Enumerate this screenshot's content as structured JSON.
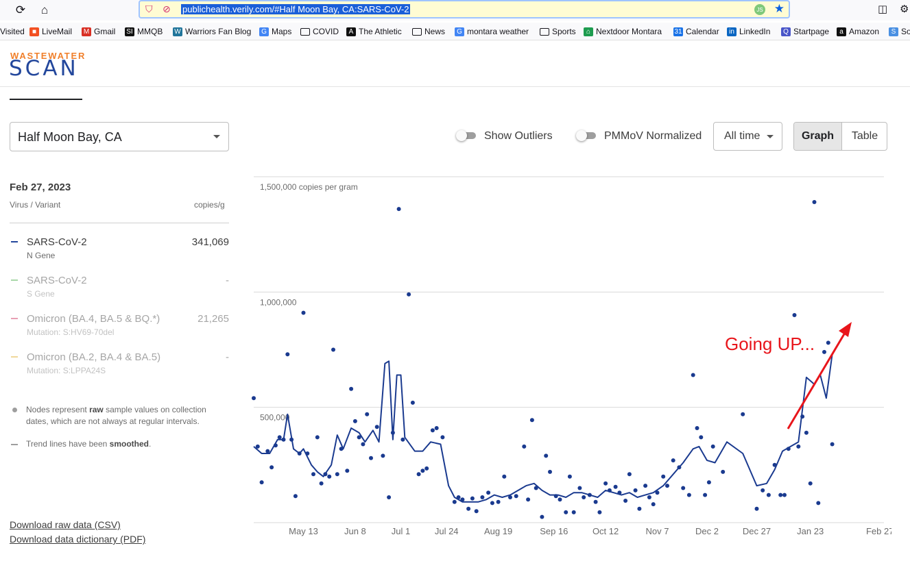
{
  "browser": {
    "url": "publichealth.verily.com/#Half Moon Bay, CA:SARS-CoV-2",
    "bookmarks": [
      {
        "label": "Visited",
        "icon": "folder-icon"
      },
      {
        "label": "LiveMail",
        "icon": "microsoft-icon",
        "color": "#f25022"
      },
      {
        "label": "Gmail",
        "icon": "gmail-icon",
        "color": "#d93025"
      },
      {
        "label": "MMQB",
        "icon": "si-icon",
        "color": "#111111"
      },
      {
        "label": "Warriors Fan Blog",
        "icon": "wordpress-icon",
        "color": "#21759b"
      },
      {
        "label": "Maps",
        "icon": "google-icon",
        "color": "#4285f4"
      },
      {
        "label": "COVID",
        "icon": "folder-icon"
      },
      {
        "label": "The Athletic",
        "icon": "athletic-icon",
        "color": "#111111"
      },
      {
        "label": "News",
        "icon": "folder-icon"
      },
      {
        "label": "montara weather",
        "icon": "google-icon",
        "color": "#4285f4"
      },
      {
        "label": "Sports",
        "icon": "folder-icon"
      },
      {
        "label": "Nextdoor Montara",
        "icon": "nextdoor-icon",
        "color": "#1e9c4f"
      },
      {
        "label": "Calendar",
        "icon": "calendar-icon",
        "color": "#1a73e8"
      },
      {
        "label": "LinkedIn",
        "icon": "linkedin-icon",
        "color": "#0a66c2"
      },
      {
        "label": "Startpage",
        "icon": "startpage-icon",
        "color": "#4a56c9"
      },
      {
        "label": "Amazon",
        "icon": "amazon-icon",
        "color": "#111111"
      },
      {
        "label": "So",
        "icon": "so-icon",
        "color": "#4a90e2"
      }
    ]
  },
  "logo": {
    "top": "WASTEWATER",
    "bottom": "SCAN"
  },
  "location": {
    "selected": "Half Moon Bay, CA"
  },
  "controls": {
    "show_outliers": "Show Outliers",
    "pmmov": "PMMoV Normalized",
    "range": "All time",
    "graph": "Graph",
    "table": "Table"
  },
  "sidebar": {
    "date": "Feb 27, 2023",
    "col_variant": "Virus / Variant",
    "col_units": "copies/g",
    "variants": [
      {
        "name": "SARS-CoV-2",
        "sub": "N Gene",
        "value": "341,069",
        "color": "#23479c",
        "active": true
      },
      {
        "name": "SARS-CoV-2",
        "sub": "S Gene",
        "value": "-",
        "color": "#a8d8a8",
        "active": false
      },
      {
        "name": "Omicron (BA.4, BA.5 & BQ.*)",
        "sub": "Mutation: S:HV69-70del",
        "value": "21,265",
        "color": "#e8a0b4",
        "active": false
      },
      {
        "name": "Omicron (BA.2, BA.4 & BA.5)",
        "sub": "Mutation: S:LPPA24S",
        "value": "-",
        "color": "#f0d89a",
        "active": false
      }
    ],
    "note1_a": "Nodes represent ",
    "note1_b": "raw",
    "note1_c": " sample values on collection dates, which are not always at regular intervals.",
    "note2_a": "Trend lines have been ",
    "note2_b": "smoothed",
    "note2_c": ".",
    "download_csv": "Download raw data (CSV)",
    "download_pdf": "Download data dictionary (PDF)"
  },
  "chart_data": {
    "type": "scatter",
    "ylabel": "1,500,000 copies per gram",
    "ylim": [
      0,
      1500000
    ],
    "yticks": [
      {
        "value": 1500000,
        "label": "1,500,000 copies per gram"
      },
      {
        "value": 1000000,
        "label": "1,000,000"
      },
      {
        "value": 500000,
        "label": "500,000"
      }
    ],
    "xlim": [
      "2022-04-18",
      "2023-03-01"
    ],
    "xticks": [
      {
        "date": "2022-05-13",
        "label": "May 13"
      },
      {
        "date": "2022-06-08",
        "label": "Jun 8"
      },
      {
        "date": "2022-07-01",
        "label": "Jul 1"
      },
      {
        "date": "2022-07-24",
        "label": "Jul 24"
      },
      {
        "date": "2022-08-19",
        "label": "Aug 19"
      },
      {
        "date": "2022-09-16",
        "label": "Sep 16"
      },
      {
        "date": "2022-10-12",
        "label": "Oct 12"
      },
      {
        "date": "2022-11-07",
        "label": "Nov 7"
      },
      {
        "date": "2022-12-02",
        "label": "Dec 2"
      },
      {
        "date": "2022-12-27",
        "label": "Dec 27"
      },
      {
        "date": "2023-01-23",
        "label": "Jan 23"
      },
      {
        "date": "2023-02-27",
        "label": "Feb 27"
      }
    ],
    "series": [
      {
        "color": "#1a3a8f",
        "points": [
          [
            "2022-04-18",
            540000
          ],
          [
            "2022-04-20",
            330000
          ],
          [
            "2022-04-22",
            175000
          ],
          [
            "2022-04-25",
            310000
          ],
          [
            "2022-04-27",
            240000
          ],
          [
            "2022-04-29",
            335000
          ],
          [
            "2022-05-01",
            370000
          ],
          [
            "2022-05-03",
            360000
          ],
          [
            "2022-05-05",
            730000
          ],
          [
            "2022-05-07",
            360000
          ],
          [
            "2022-05-09",
            115000
          ],
          [
            "2022-05-11",
            300000
          ],
          [
            "2022-05-13",
            910000
          ],
          [
            "2022-05-15",
            300000
          ],
          [
            "2022-05-18",
            210000
          ],
          [
            "2022-05-20",
            370000
          ],
          [
            "2022-05-22",
            170000
          ],
          [
            "2022-05-24",
            210000
          ],
          [
            "2022-05-26",
            200000
          ],
          [
            "2022-05-28",
            750000
          ],
          [
            "2022-05-30",
            210000
          ],
          [
            "2022-06-01",
            320000
          ],
          [
            "2022-06-04",
            225000
          ],
          [
            "2022-06-06",
            580000
          ],
          [
            "2022-06-08",
            440000
          ],
          [
            "2022-06-10",
            370000
          ],
          [
            "2022-06-12",
            340000
          ],
          [
            "2022-06-14",
            470000
          ],
          [
            "2022-06-16",
            280000
          ],
          [
            "2022-06-19",
            415000
          ],
          [
            "2022-06-22",
            290000
          ],
          [
            "2022-06-25",
            110000
          ],
          [
            "2022-06-27",
            390000
          ],
          [
            "2022-06-30",
            1360000
          ],
          [
            "2022-07-02",
            360000
          ],
          [
            "2022-07-05",
            990000
          ],
          [
            "2022-07-07",
            520000
          ],
          [
            "2022-07-10",
            210000
          ],
          [
            "2022-07-12",
            225000
          ],
          [
            "2022-07-14",
            235000
          ],
          [
            "2022-07-17",
            400000
          ],
          [
            "2022-07-19",
            410000
          ],
          [
            "2022-07-22",
            370000
          ],
          [
            "2022-07-28",
            90000
          ],
          [
            "2022-07-30",
            110000
          ],
          [
            "2022-08-01",
            100000
          ],
          [
            "2022-08-04",
            60000
          ],
          [
            "2022-08-06",
            105000
          ],
          [
            "2022-08-08",
            50000
          ],
          [
            "2022-08-11",
            110000
          ],
          [
            "2022-08-14",
            130000
          ],
          [
            "2022-08-16",
            85000
          ],
          [
            "2022-08-19",
            90000
          ],
          [
            "2022-08-22",
            200000
          ],
          [
            "2022-08-25",
            110000
          ],
          [
            "2022-08-28",
            115000
          ],
          [
            "2022-09-01",
            330000
          ],
          [
            "2022-09-03",
            100000
          ],
          [
            "2022-09-05",
            445000
          ],
          [
            "2022-09-07",
            150000
          ],
          [
            "2022-09-10",
            25000
          ],
          [
            "2022-09-12",
            290000
          ],
          [
            "2022-09-14",
            220000
          ],
          [
            "2022-09-17",
            115000
          ],
          [
            "2022-09-19",
            100000
          ],
          [
            "2022-09-22",
            45000
          ],
          [
            "2022-09-24",
            200000
          ],
          [
            "2022-09-26",
            45000
          ],
          [
            "2022-09-29",
            150000
          ],
          [
            "2022-10-01",
            110000
          ],
          [
            "2022-10-04",
            120000
          ],
          [
            "2022-10-07",
            90000
          ],
          [
            "2022-10-09",
            45000
          ],
          [
            "2022-10-12",
            170000
          ],
          [
            "2022-10-14",
            140000
          ],
          [
            "2022-10-17",
            155000
          ],
          [
            "2022-10-19",
            130000
          ],
          [
            "2022-10-22",
            95000
          ],
          [
            "2022-10-24",
            210000
          ],
          [
            "2022-10-27",
            140000
          ],
          [
            "2022-10-29",
            60000
          ],
          [
            "2022-11-01",
            160000
          ],
          [
            "2022-11-03",
            110000
          ],
          [
            "2022-11-05",
            80000
          ],
          [
            "2022-11-07",
            130000
          ],
          [
            "2022-11-10",
            200000
          ],
          [
            "2022-11-12",
            160000
          ],
          [
            "2022-11-15",
            270000
          ],
          [
            "2022-11-18",
            240000
          ],
          [
            "2022-11-20",
            150000
          ],
          [
            "2022-11-23",
            120000
          ],
          [
            "2022-11-25",
            640000
          ],
          [
            "2022-11-27",
            410000
          ],
          [
            "2022-11-29",
            370000
          ],
          [
            "2022-12-01",
            120000
          ],
          [
            "2022-12-03",
            175000
          ],
          [
            "2022-12-05",
            330000
          ],
          [
            "2022-12-10",
            220000
          ],
          [
            "2022-12-20",
            470000
          ],
          [
            "2022-12-27",
            60000
          ],
          [
            "2022-12-30",
            140000
          ],
          [
            "2023-01-02",
            120000
          ],
          [
            "2023-01-05",
            250000
          ],
          [
            "2023-01-08",
            120000
          ],
          [
            "2023-01-10",
            120000
          ],
          [
            "2023-01-12",
            320000
          ],
          [
            "2023-01-15",
            900000
          ],
          [
            "2023-01-17",
            330000
          ],
          [
            "2023-01-19",
            460000
          ],
          [
            "2023-01-21",
            390000
          ],
          [
            "2023-01-23",
            170000
          ],
          [
            "2023-01-25",
            1390000
          ],
          [
            "2023-01-27",
            85000
          ],
          [
            "2023-01-30",
            740000
          ],
          [
            "2023-02-01",
            780000
          ],
          [
            "2023-02-03",
            340000
          ]
        ],
        "trend": [
          [
            "2022-04-18",
            330000
          ],
          [
            "2022-04-22",
            300000
          ],
          [
            "2022-04-26",
            300000
          ],
          [
            "2022-04-30",
            360000
          ],
          [
            "2022-05-03",
            360000
          ],
          [
            "2022-05-05",
            470000
          ],
          [
            "2022-05-08",
            320000
          ],
          [
            "2022-05-11",
            300000
          ],
          [
            "2022-05-13",
            320000
          ],
          [
            "2022-05-17",
            250000
          ],
          [
            "2022-05-20",
            220000
          ],
          [
            "2022-05-23",
            200000
          ],
          [
            "2022-05-27",
            250000
          ],
          [
            "2022-05-30",
            380000
          ],
          [
            "2022-06-02",
            320000
          ],
          [
            "2022-06-06",
            410000
          ],
          [
            "2022-06-10",
            390000
          ],
          [
            "2022-06-13",
            350000
          ],
          [
            "2022-06-17",
            400000
          ],
          [
            "2022-06-20",
            350000
          ],
          [
            "2022-06-23",
            690000
          ],
          [
            "2022-06-25",
            700000
          ],
          [
            "2022-06-27",
            360000
          ],
          [
            "2022-06-29",
            640000
          ],
          [
            "2022-07-01",
            640000
          ],
          [
            "2022-07-03",
            370000
          ],
          [
            "2022-07-08",
            310000
          ],
          [
            "2022-07-12",
            310000
          ],
          [
            "2022-07-16",
            350000
          ],
          [
            "2022-07-21",
            340000
          ],
          [
            "2022-07-25",
            160000
          ],
          [
            "2022-07-28",
            110000
          ],
          [
            "2022-08-01",
            90000
          ],
          [
            "2022-08-05",
            90000
          ],
          [
            "2022-08-09",
            90000
          ],
          [
            "2022-08-13",
            100000
          ],
          [
            "2022-08-17",
            120000
          ],
          [
            "2022-08-21",
            110000
          ],
          [
            "2022-08-25",
            120000
          ],
          [
            "2022-08-29",
            140000
          ],
          [
            "2022-09-02",
            160000
          ],
          [
            "2022-09-06",
            170000
          ],
          [
            "2022-09-10",
            140000
          ],
          [
            "2022-09-14",
            120000
          ],
          [
            "2022-09-18",
            120000
          ],
          [
            "2022-09-22",
            110000
          ],
          [
            "2022-09-26",
            130000
          ],
          [
            "2022-09-30",
            130000
          ],
          [
            "2022-10-04",
            120000
          ],
          [
            "2022-10-08",
            110000
          ],
          [
            "2022-10-12",
            140000
          ],
          [
            "2022-10-16",
            130000
          ],
          [
            "2022-10-20",
            120000
          ],
          [
            "2022-10-24",
            130000
          ],
          [
            "2022-10-28",
            110000
          ],
          [
            "2022-11-01",
            120000
          ],
          [
            "2022-11-05",
            130000
          ],
          [
            "2022-11-10",
            160000
          ],
          [
            "2022-11-15",
            210000
          ],
          [
            "2022-11-20",
            260000
          ],
          [
            "2022-11-25",
            320000
          ],
          [
            "2022-11-28",
            330000
          ],
          [
            "2022-12-02",
            270000
          ],
          [
            "2022-12-06",
            260000
          ],
          [
            "2022-12-12",
            350000
          ],
          [
            "2022-12-20",
            300000
          ],
          [
            "2022-12-27",
            160000
          ],
          [
            "2023-01-01",
            170000
          ],
          [
            "2023-01-05",
            230000
          ],
          [
            "2023-01-09",
            310000
          ],
          [
            "2023-01-13",
            330000
          ],
          [
            "2023-01-17",
            350000
          ],
          [
            "2023-01-21",
            630000
          ],
          [
            "2023-01-25",
            600000
          ],
          [
            "2023-01-28",
            640000
          ],
          [
            "2023-01-31",
            540000
          ],
          [
            "2023-02-03",
            730000
          ]
        ]
      }
    ],
    "annotations": [
      {
        "text": "Going UP...",
        "color": "#e8151b"
      }
    ]
  }
}
